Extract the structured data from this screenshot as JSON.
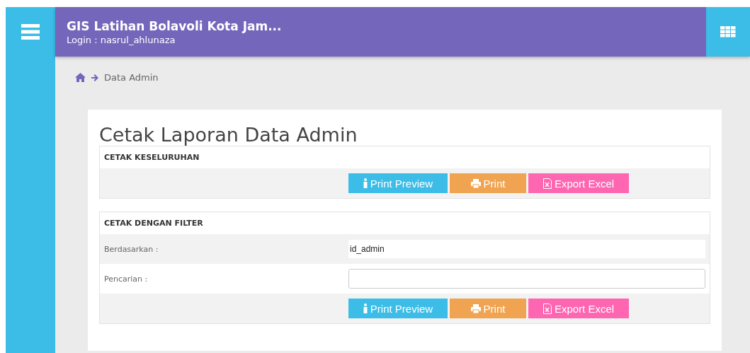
{
  "header": {
    "title": "GIS Latihan Bolavoli Kota Jam...",
    "subtitle": "Login : nasrul_ahlunaza"
  },
  "breadcrumb": {
    "current": "Data Admin"
  },
  "page_title": "Cetak Laporan Data Admin",
  "sections": [
    {
      "heading": "CETAK KESELURUHAN",
      "buttons": [
        {
          "kind": "preview",
          "label": "Print Preview"
        },
        {
          "kind": "print",
          "label": "Print"
        },
        {
          "kind": "excel",
          "label": "Export Excel"
        }
      ]
    },
    {
      "heading": "CETAK DENGAN FILTER",
      "fields": [
        {
          "kind": "select",
          "label": "Berdasarkan :",
          "value": "id_admin"
        },
        {
          "kind": "text",
          "label": "Pencarian :"
        }
      ],
      "buttons": [
        {
          "kind": "preview",
          "label": "Print Preview"
        },
        {
          "kind": "print",
          "label": "Print"
        },
        {
          "kind": "excel",
          "label": "Export Excel"
        }
      ]
    }
  ]
}
